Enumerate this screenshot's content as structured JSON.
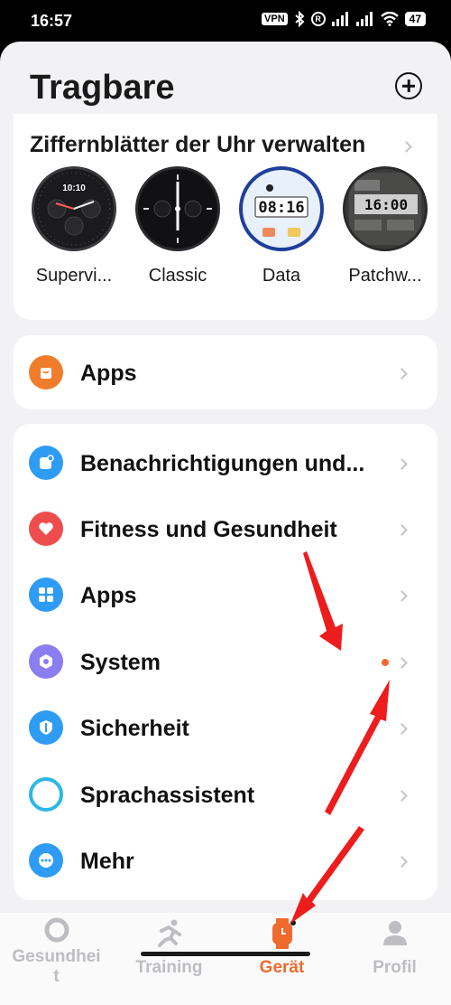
{
  "status_bar": {
    "time": "16:57",
    "vpn": "VPN",
    "registered": "R",
    "battery": "47"
  },
  "header": {
    "title": "Tragbare"
  },
  "watchfaces": {
    "title": "Ziffernblätter der Uhr verwalten",
    "items": [
      {
        "name": "Supervi...",
        "time_text": "10:10"
      },
      {
        "name": "Classic",
        "time_text": ""
      },
      {
        "name": "Data",
        "time_text": "08:16"
      },
      {
        "name": "Patchw...",
        "time_text": "16:00"
      }
    ]
  },
  "apps_card": {
    "label": "Apps",
    "icon": "shopping-bag-icon",
    "color": "#f07d2c"
  },
  "menu": {
    "items": [
      {
        "label": "Benachrichtigungen und...",
        "icon": "notification-icon",
        "color": "#2e9cf5"
      },
      {
        "label": "Fitness und Gesundheit",
        "icon": "heart-icon",
        "color": "#ef4d4d"
      },
      {
        "label": "Apps",
        "icon": "apps-grid-icon",
        "color": "#2e9cf5"
      },
      {
        "label": "System",
        "icon": "system-icon",
        "color": "#8b7ef0"
      },
      {
        "label": "Sicherheit",
        "icon": "shield-icon",
        "color": "#2e9cf5"
      },
      {
        "label": "Sprachassistent",
        "icon": "alexa-icon",
        "color": "#2bb8e6"
      },
      {
        "label": "Mehr",
        "icon": "more-icon",
        "color": "#2e9cf5"
      }
    ]
  },
  "nav": {
    "items": [
      {
        "label": "Gesundheit",
        "icon": "ring-icon",
        "active": false
      },
      {
        "label": "Training",
        "icon": "runner-icon",
        "active": false
      },
      {
        "label": "Gerät",
        "icon": "watch-icon",
        "active": true
      },
      {
        "label": "Profil",
        "icon": "person-icon",
        "active": false
      }
    ],
    "active_color": "#f06a2e"
  }
}
